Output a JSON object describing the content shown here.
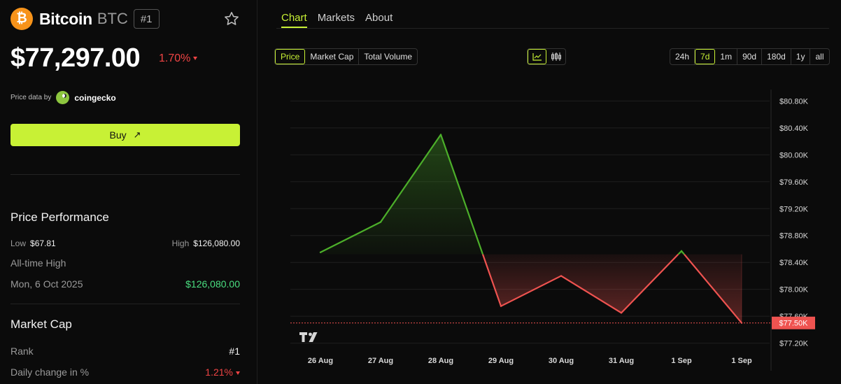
{
  "coin": {
    "logo_glyph": "₿",
    "name": "Bitcoin",
    "symbol": "BTC",
    "rank_badge": "#1",
    "favorite_icon": "star-icon",
    "price": "$77,297.00",
    "change_pct": "1.70%",
    "change_direction": "down",
    "price_data_label": "Price data by",
    "price_data_source": "coingecko",
    "buy_label": "Buy",
    "buy_icon": "arrow-up-right-icon"
  },
  "price_performance": {
    "title": "Price Performance",
    "low_label": "Low",
    "low_value": "$67.81",
    "high_label": "High",
    "high_value": "$126,080.00",
    "ath_label": "All-time High",
    "ath_date": "Mon, 6 Oct 2025",
    "ath_value": "$126,080.00"
  },
  "market_cap": {
    "title": "Market Cap",
    "rank_label": "Rank",
    "rank_value": "#1",
    "daily_change_label": "Daily change in %",
    "daily_change_value": "1.21%"
  },
  "tabs": [
    "Chart",
    "Markets",
    "About"
  ],
  "active_tab": "Chart",
  "metric_options": [
    "Price",
    "Market Cap",
    "Total Volume"
  ],
  "active_metric": "Price",
  "chart_type_options": [
    "line-chart-icon",
    "candlestick-icon"
  ],
  "active_chart_type": "line-chart-icon",
  "range_options": [
    "24h",
    "7d",
    "1m",
    "90d",
    "180d",
    "1y",
    "all"
  ],
  "active_range": "7d",
  "colors": {
    "accent": "#c8f135",
    "up": "#4caf2a",
    "down": "#ef5350",
    "background": "#0b0b0b"
  },
  "chart_data": {
    "type": "line",
    "x": [
      "26 Aug",
      "27 Aug",
      "28 Aug",
      "29 Aug",
      "30 Aug",
      "31 Aug",
      "1 Sep",
      "1 Sep"
    ],
    "values": [
      78.55,
      79.0,
      80.3,
      77.75,
      78.2,
      77.65,
      78.57,
      77.5
    ],
    "baseline": 78.52,
    "y_ticks": [
      "$80.80K",
      "$80.40K",
      "$80.00K",
      "$79.60K",
      "$79.20K",
      "$78.80K",
      "$78.40K",
      "$78.00K",
      "$77.60K",
      "$77.20K"
    ],
    "y_tick_values": [
      80.8,
      80.4,
      80.0,
      79.6,
      79.2,
      78.8,
      78.4,
      78.0,
      77.6,
      77.2
    ],
    "ylim": [
      77.05,
      80.95
    ],
    "last_price_label": "$77.50K",
    "last_price_value": 77.5,
    "grid": true,
    "watermark": "TV"
  }
}
